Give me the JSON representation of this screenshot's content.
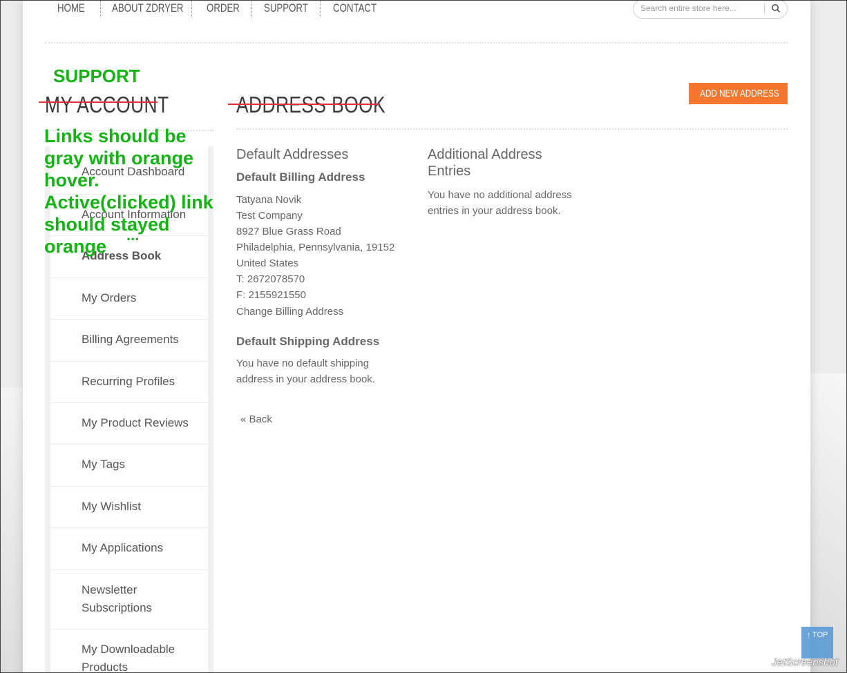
{
  "nav": {
    "items": [
      "HOME",
      "ABOUT ZDRYER",
      "ORDER",
      "SUPPORT",
      "CONTACT"
    ]
  },
  "search": {
    "placeholder": "Search entire store here...",
    "icon": "search-icon"
  },
  "sidebar": {
    "title": "MY ACCOUNT",
    "items": [
      "Account Dashboard",
      "Account Information",
      "Address Book",
      "My Orders",
      "Billing Agreements",
      "Recurring Profiles",
      "My Product Reviews",
      "My Tags",
      "My Wishlist",
      "My Applications",
      "Newsletter Subscriptions",
      "My Downloadable Products"
    ],
    "active": "Address Book"
  },
  "main": {
    "title": "ADDRESS BOOK",
    "add_button": "ADD NEW ADDRESS",
    "default_addresses": {
      "heading": "Default Addresses",
      "billing": {
        "heading": "Default Billing Address",
        "lines": [
          "Tatyana Novik",
          "Test Company",
          "8927 Blue Grass Road",
          "Philadelphia, Pennsylvania, 19152",
          "United States",
          "T: 2672078570",
          "F: 2155921550"
        ],
        "change_link": "Change Billing Address"
      },
      "shipping": {
        "heading": "Default Shipping Address",
        "lines": [
          "You have no default shipping",
          "address in your address book."
        ]
      }
    },
    "additional": {
      "heading_lines": [
        "Additional Address",
        "Entries"
      ],
      "lines": [
        "You have no additional address",
        "entries in your address book."
      ]
    },
    "back_link": "« Back"
  },
  "annotations": {
    "support": "SUPPORT",
    "note_lines": [
      "Links should be",
      "gray with orange",
      "hover.",
      "Active(clicked) link",
      "should stayed",
      "orange",
      "..."
    ],
    "color": "#14b414",
    "strike_color": "#e0303a"
  },
  "top_button": {
    "label": "↑ TOP"
  },
  "watermark": "JetScreenshot",
  "colors": {
    "accent": "#f7762d",
    "text": "#666666"
  }
}
